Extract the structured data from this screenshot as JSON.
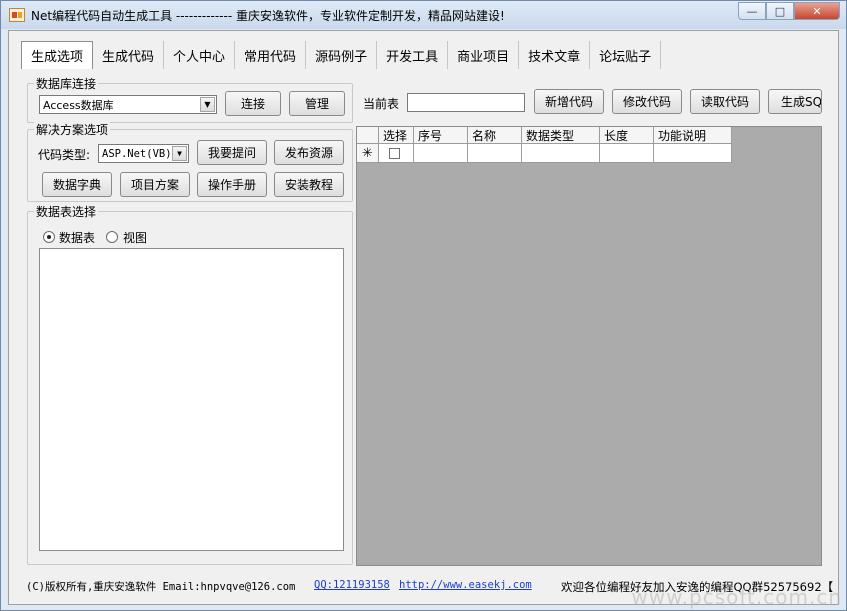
{
  "window": {
    "title": "Net编程代码自动生成工具 ------------- 重庆安逸软件，专业软件定制开发，精品网站建设!",
    "minimize": "—",
    "maximize": "□",
    "close": "✕"
  },
  "tabs": [
    "生成选项",
    "生成代码",
    "个人中心",
    "常用代码",
    "源码例子",
    "开发工具",
    "商业项目",
    "技术文章",
    "论坛贴子"
  ],
  "db_group": {
    "label": "数据库连接",
    "db_type_value": "Access数据库",
    "connect_button": "连接",
    "manage_button": "管理"
  },
  "solution_group": {
    "label": "解决方案选项",
    "code_type_label": "代码类型:",
    "code_type_value": "ASP.Net(VB)",
    "ask_button": "我要提问",
    "publish_button": "发布资源",
    "dictionary_button": "数据字典",
    "project_button": "项目方案",
    "manual_button": "操作手册",
    "install_button": "安装教程"
  },
  "table_group": {
    "label": "数据表选择",
    "radio_table": "数据表",
    "radio_view": "视图",
    "selected": "数据表"
  },
  "toolbar": {
    "current_table_label": "当前表",
    "current_table_value": "",
    "add_code_button": "新增代码",
    "edit_code_button": "修改代码",
    "read_code_button": "读取代码",
    "gen_sql_button": "生成SQL"
  },
  "grid": {
    "columns": [
      "选择",
      "序号",
      "名称",
      "数据类型",
      "长度",
      "功能说明"
    ],
    "new_row_marker": "✳"
  },
  "status": {
    "copyright": "(C)版权所有,重庆安逸软件 Email:hnpvqve@126.com",
    "qq": "QQ:121193158",
    "url": "http://www.easekj.com",
    "welcome": "欢迎各位编程好友加入安逸的编程QQ群52575692【"
  },
  "watermark": "www.pcsoft.com.cn"
}
